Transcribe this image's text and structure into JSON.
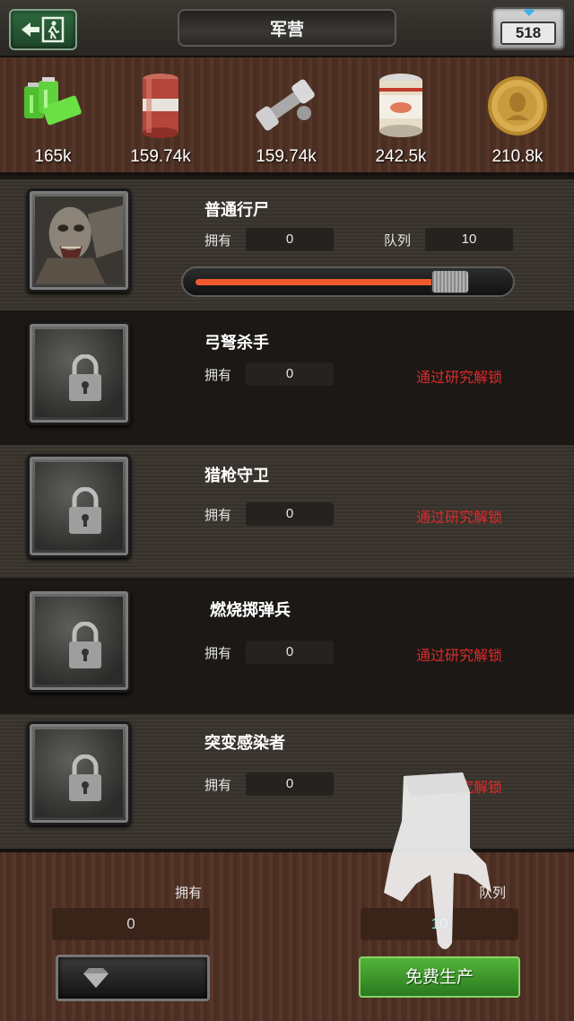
{
  "header": {
    "title": "军营",
    "gems": "518"
  },
  "resources": [
    {
      "name": "battery-icon",
      "value": "165k"
    },
    {
      "name": "oil-barrel-icon",
      "value": "159.74k"
    },
    {
      "name": "wrench-icon",
      "value": "159.74k"
    },
    {
      "name": "canned-food-icon",
      "value": "242.5k"
    },
    {
      "name": "gold-coin-icon",
      "value": "210.8k"
    }
  ],
  "units": [
    {
      "name": "普通行尸",
      "own_label": "拥有",
      "own": "0",
      "queue_label": "队列",
      "queue": "10",
      "progress": 0.79,
      "locked": false
    },
    {
      "name": "弓弩杀手",
      "own_label": "拥有",
      "own": "0",
      "unlock": "通过研究解锁",
      "locked": true
    },
    {
      "name": "猎枪守卫",
      "own_label": "拥有",
      "own": "0",
      "unlock": "通过研究解锁",
      "locked": true
    },
    {
      "name": "燃烧掷弹兵",
      "own_label": "拥有",
      "own": "0",
      "unlock": "通过研究解锁",
      "locked": true
    },
    {
      "name": "突变感染者",
      "own_label": "拥有",
      "own": "0",
      "unlock": "通过研究解锁",
      "locked": true
    }
  ],
  "bottom": {
    "own_label": "拥有",
    "own": "0",
    "queue_label": "队列",
    "queue": "10",
    "free_produce": "免费生产"
  },
  "colors": {
    "unlock_text": "#e02a2a",
    "progress_fill": "#f15a2e",
    "produce_button": "#3d9a2b"
  }
}
